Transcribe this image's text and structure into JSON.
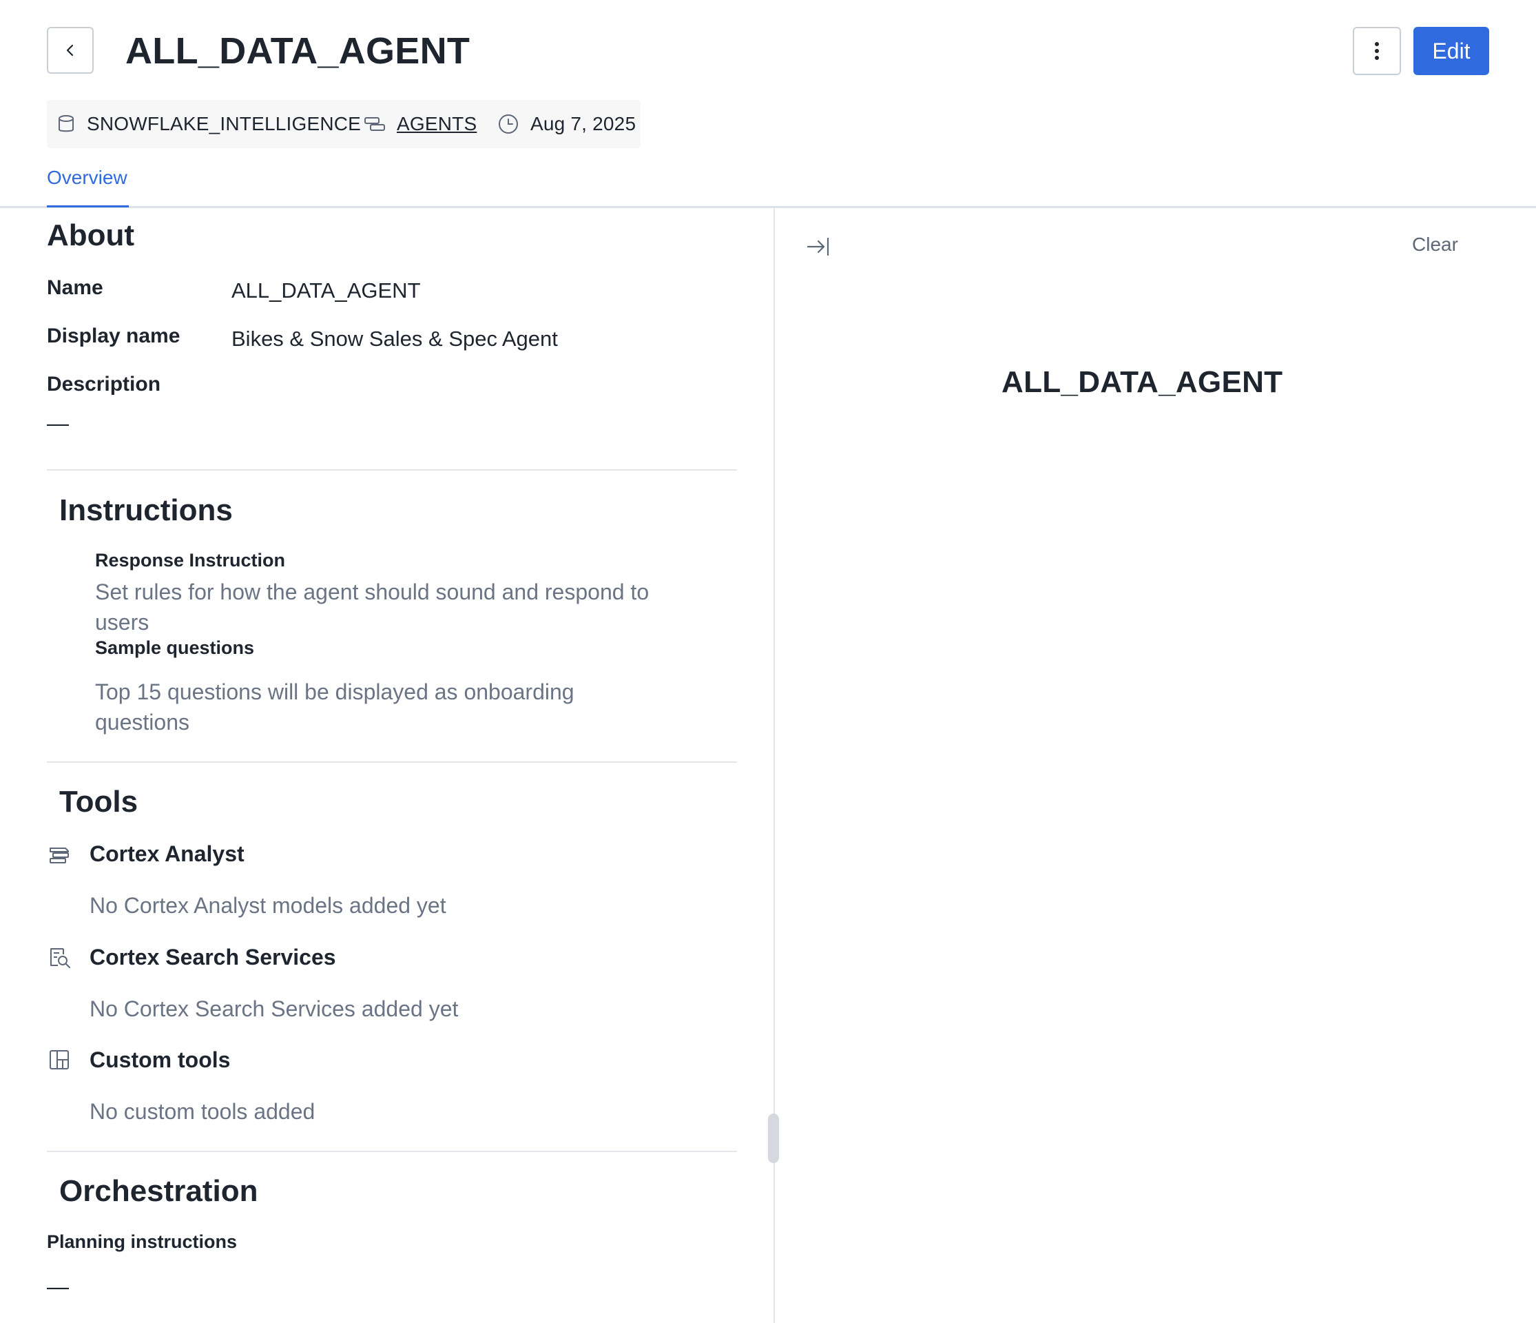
{
  "header": {
    "title": "ALL_DATA_AGENT",
    "edit_label": "Edit"
  },
  "meta": {
    "database": "SNOWFLAKE_INTELLIGENCE",
    "schema": "AGENTS",
    "date": "Aug 7, 2025"
  },
  "tabs": [
    {
      "label": "Overview",
      "active": true
    }
  ],
  "about": {
    "heading": "About",
    "name_label": "Name",
    "name_value": "ALL_DATA_AGENT",
    "display_name_label": "Display name",
    "display_name_value": "Bikes & Snow Sales & Spec Agent",
    "description_label": "Description",
    "description_value": "—"
  },
  "instructions": {
    "heading": "Instructions",
    "response_label": "Response Instruction",
    "response_line1": "Set rules for how the agent should sound and respond to",
    "response_line2": "users",
    "sample_label": "Sample questions",
    "sample_line1": "Top 15 questions will be displayed as onboarding",
    "sample_line2": "questions"
  },
  "tools": {
    "heading": "Tools",
    "items": [
      {
        "icon": "semantic-model-icon",
        "title": "Cortex Analyst",
        "empty": "No Cortex Analyst models added yet"
      },
      {
        "icon": "search-document-icon",
        "title": "Cortex Search Services",
        "empty": "No Cortex Search Services added yet"
      },
      {
        "icon": "grid-icon",
        "title": "Custom tools",
        "empty": "No custom tools added"
      }
    ]
  },
  "orchestration": {
    "heading": "Orchestration",
    "planning_label": "Planning instructions",
    "planning_value": "—"
  },
  "right_panel": {
    "clear_label": "Clear",
    "title": "ALL_DATA_AGENT"
  },
  "colors": {
    "accent": "#2f6bde",
    "text": "#1e252f",
    "muted": "#6a7485",
    "divider": "#e3e6ea"
  }
}
